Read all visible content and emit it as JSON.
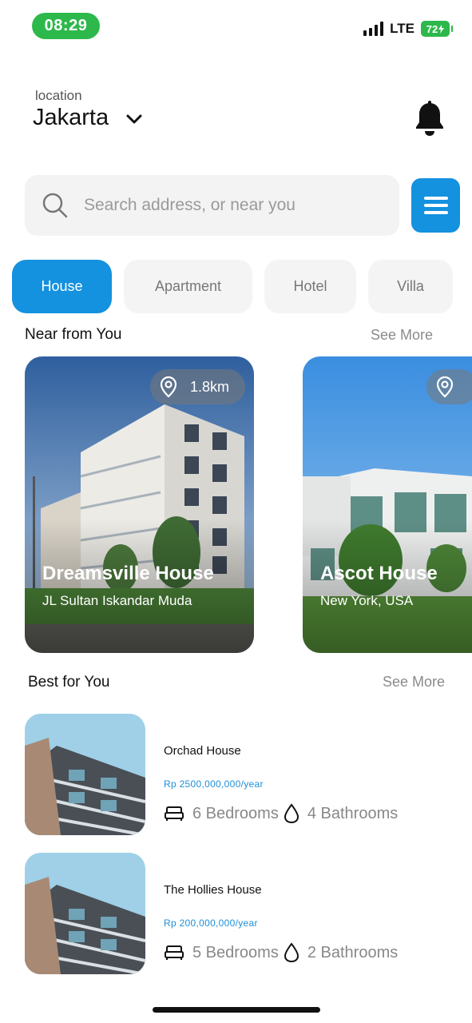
{
  "status_bar": {
    "time": "08:29",
    "network": "LTE",
    "battery": "72"
  },
  "header": {
    "location_label": "location",
    "location_city": "Jakarta"
  },
  "search": {
    "placeholder": "Search address, or near you"
  },
  "tabs": [
    {
      "label": "House",
      "active": true
    },
    {
      "label": "Apartment",
      "active": false
    },
    {
      "label": "Hotel",
      "active": false
    },
    {
      "label": "Villa",
      "active": false
    }
  ],
  "near": {
    "title": "Near from You",
    "see_more": "See More",
    "items": [
      {
        "name": "Dreamsville House",
        "address": "JL Sultan Iskandar Muda",
        "distance": "1.8km"
      },
      {
        "name": "Ascot House",
        "address": "New York, USA",
        "distance": ""
      }
    ]
  },
  "best": {
    "title": "Best for You",
    "see_more": "See More",
    "items": [
      {
        "name": "Orchad House",
        "price": "Rp 2500,000,000/year",
        "bedrooms": "6 Bedrooms",
        "bathrooms": "4 Bathrooms"
      },
      {
        "name": "The Hollies House",
        "price": "Rp 200,000,000/year",
        "bedrooms": "5 Bedrooms",
        "bathrooms": "2 Bathrooms"
      }
    ]
  },
  "colors": {
    "accent": "#1491df",
    "status_green": "#2db84b",
    "price_blue": "#1e8fd8"
  }
}
